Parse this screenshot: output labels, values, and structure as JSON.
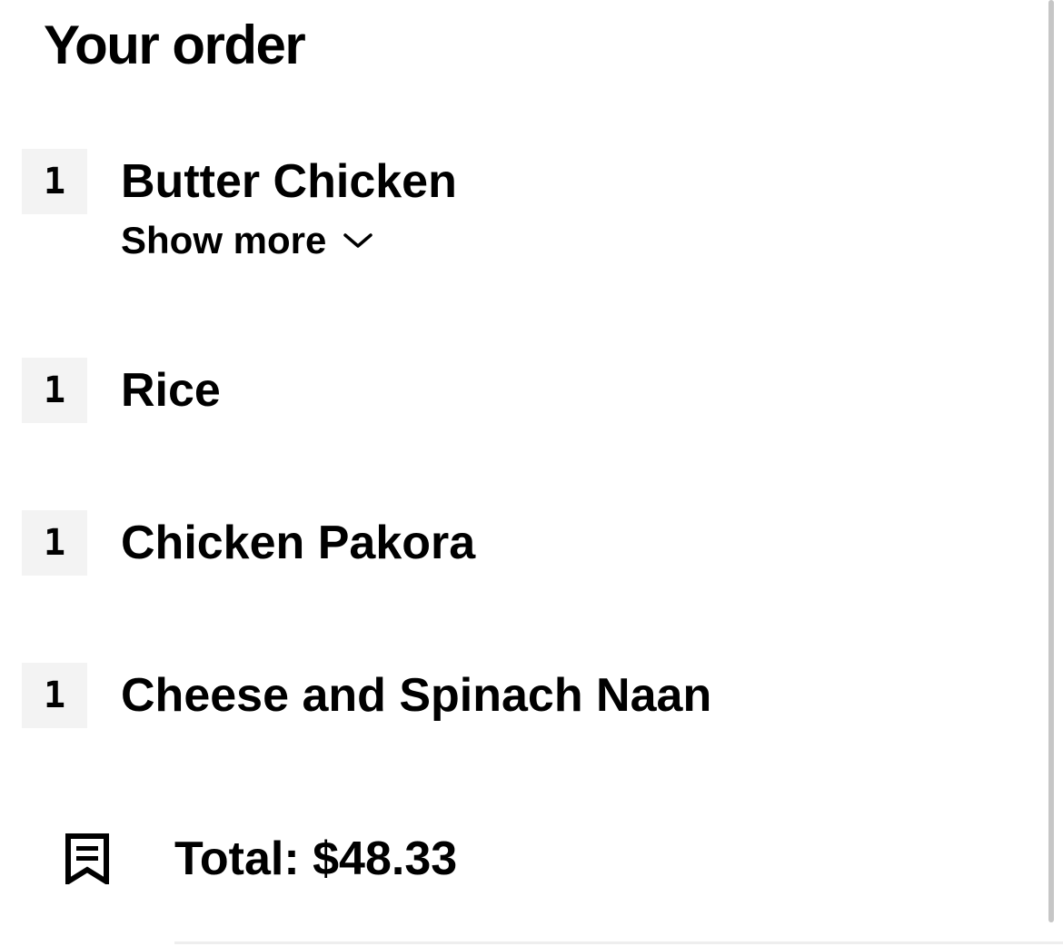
{
  "header": {
    "title": "Your order"
  },
  "order": {
    "items": [
      {
        "qty": "1",
        "name": "Butter Chicken",
        "show_more": "Show more"
      },
      {
        "qty": "1",
        "name": "Rice"
      },
      {
        "qty": "1",
        "name": "Chicken Pakora"
      },
      {
        "qty": "1",
        "name": "Cheese and Spinach Naan"
      }
    ],
    "total_label": "Total: $48.33"
  },
  "icons": {
    "show_more": "chevron-down-icon",
    "total": "receipt-icon"
  },
  "colors": {
    "text": "#000000",
    "quantity_background": "#f3f3f3",
    "divider": "#eeeeee",
    "scrollbar": "#c6c6c6"
  }
}
